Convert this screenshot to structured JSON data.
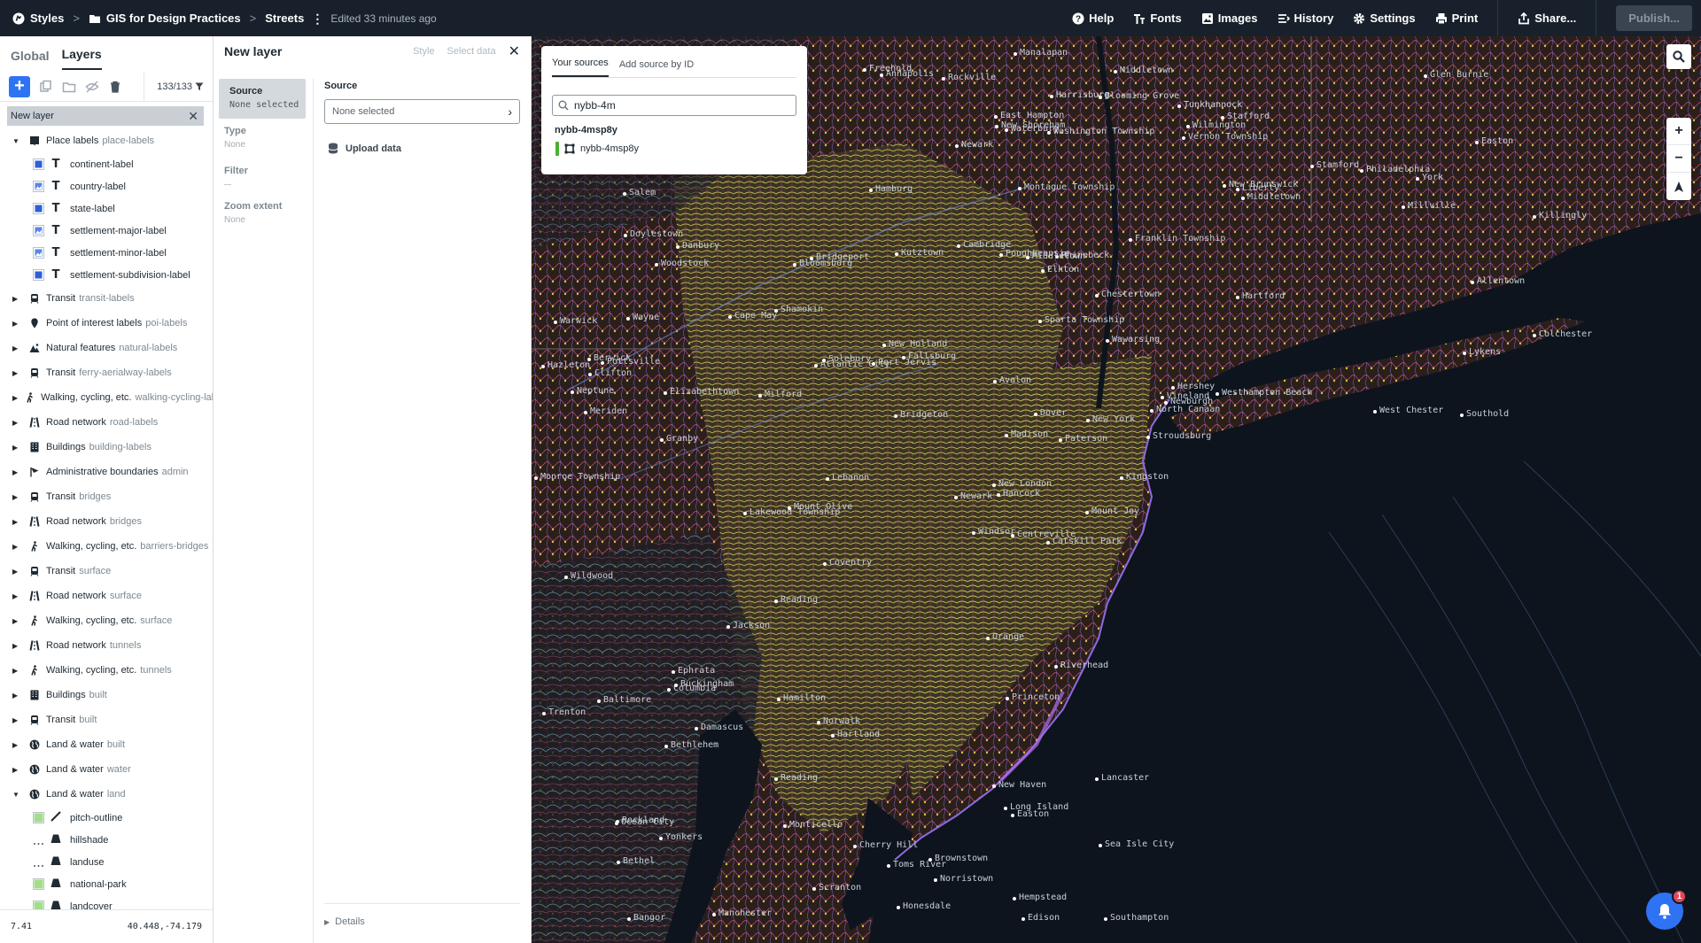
{
  "topbar": {
    "styles": "Styles",
    "project": "GIS for Design Practices",
    "style_name": "Streets",
    "edited": "Edited 33 minutes ago",
    "help": "Help",
    "fonts": "Fonts",
    "images": "Images",
    "history": "History",
    "settings": "Settings",
    "print": "Print",
    "share": "Share...",
    "publish": "Publish..."
  },
  "left_panel": {
    "tabs": [
      "Global",
      "Layers"
    ],
    "active_tab": "Layers",
    "layer_count": "133/133",
    "new_layer_row": "New layer",
    "groups": [
      {
        "name": "Place labels",
        "sub": "place-labels",
        "expanded": true,
        "icon": "label-icon",
        "children": [
          {
            "name": "continent-label",
            "swatch": "blue"
          },
          {
            "name": "country-label",
            "swatch": "image"
          },
          {
            "name": "state-label",
            "swatch": "blue"
          },
          {
            "name": "settlement-major-label",
            "swatch": "image"
          },
          {
            "name": "settlement-minor-label",
            "swatch": "image"
          },
          {
            "name": "settlement-subdivision-label",
            "swatch": "blue"
          }
        ]
      },
      {
        "name": "Transit",
        "sub": "transit-labels",
        "icon": "transit-icon"
      },
      {
        "name": "Point of interest labels",
        "sub": "poi-labels",
        "icon": "pin-icon"
      },
      {
        "name": "Natural features",
        "sub": "natural-labels",
        "icon": "mountain-icon"
      },
      {
        "name": "Transit",
        "sub": "ferry-aerialway-labels",
        "icon": "transit-icon"
      },
      {
        "name": "Walking, cycling, etc.",
        "sub": "walking-cycling-lal",
        "icon": "walker-icon"
      },
      {
        "name": "Road network",
        "sub": "road-labels",
        "icon": "road-icon"
      },
      {
        "name": "Buildings",
        "sub": "building-labels",
        "icon": "building-icon"
      },
      {
        "name": "Administrative boundaries",
        "sub": "admin",
        "icon": "flag-icon"
      },
      {
        "name": "Transit",
        "sub": "bridges",
        "icon": "transit-icon"
      },
      {
        "name": "Road network",
        "sub": "bridges",
        "icon": "road-icon"
      },
      {
        "name": "Walking, cycling, etc.",
        "sub": "barriers-bridges",
        "icon": "walker-icon"
      },
      {
        "name": "Transit",
        "sub": "surface",
        "icon": "transit-icon"
      },
      {
        "name": "Road network",
        "sub": "surface",
        "icon": "road-icon"
      },
      {
        "name": "Walking, cycling, etc.",
        "sub": "surface",
        "icon": "walker-icon"
      },
      {
        "name": "Road network",
        "sub": "tunnels",
        "icon": "road-icon"
      },
      {
        "name": "Walking, cycling, etc.",
        "sub": "tunnels",
        "icon": "walker-icon"
      },
      {
        "name": "Buildings",
        "sub": "built",
        "icon": "building-icon"
      },
      {
        "name": "Transit",
        "sub": "built",
        "icon": "transit-icon"
      },
      {
        "name": "Land & water",
        "sub": "built",
        "icon": "globe-icon"
      },
      {
        "name": "Land & water",
        "sub": "water",
        "icon": "globe-icon"
      },
      {
        "name": "Land & water",
        "sub": "land",
        "expanded": true,
        "icon": "globe-icon",
        "children": [
          {
            "name": "pitch-outline",
            "swatch": "green",
            "type": "line"
          },
          {
            "name": "hillshade",
            "swatch": "dots",
            "type": "fill"
          },
          {
            "name": "landuse",
            "swatch": "dots",
            "type": "fill"
          },
          {
            "name": "national-park",
            "swatch": "green",
            "type": "fill"
          },
          {
            "name": "landcover",
            "swatch": "green",
            "type": "fill"
          }
        ]
      }
    ],
    "footer_zoom": "7.41",
    "footer_coords": "40.448,-74.179"
  },
  "editor": {
    "title": "New layer",
    "tab_style": "Style",
    "tab_select_data": "Select data",
    "nav": [
      {
        "label": "Source",
        "value": "None selected",
        "active": true
      },
      {
        "label": "Type",
        "value": "None"
      },
      {
        "label": "Filter",
        "value": ""
      },
      {
        "label": "Zoom extent",
        "value": "None"
      }
    ],
    "source_label": "Source",
    "source_select": "None selected",
    "upload": "Upload data",
    "details": "Details"
  },
  "popup": {
    "tabs": [
      "Your sources",
      "Add source by ID"
    ],
    "search_value": "nybb-4m",
    "group": "nybb-4msp8y",
    "item": "nybb-4msp8y"
  },
  "map_labels": [
    "Catskill Park",
    "Woodstock",
    "Hancock",
    "Rockland",
    "North Canaan",
    "Hartland",
    "Stafford",
    "Rhinebeck",
    "Liberty",
    "Kingston",
    "Granby",
    "Killingly",
    "Windsor",
    "Hartford",
    "Manchester",
    "Poughkeepsie",
    "Wawarsing",
    "Damascus",
    "Fallsburg",
    "Bethel",
    "Monticello",
    "Middletown",
    "Newburgh",
    "Danbury",
    "Waterbury",
    "Meriden",
    "Colchester",
    "New London",
    "New Haven",
    "Madison",
    "Bridgeport",
    "Stamford",
    "Norwalk",
    "Middletown",
    "Port Jervis",
    "Milford",
    "Scranton",
    "Hazleton",
    "Stroudsburg",
    "Bangor",
    "Easton",
    "Bethlehem",
    "Allentown",
    "Reading",
    "Lancaster",
    "York",
    "Harrisburg",
    "Lebanon",
    "Pottsville",
    "Shamokin",
    "Philadelphia",
    "Wilmington",
    "Newark",
    "Dover",
    "Trenton",
    "Princeton",
    "Toms River",
    "Atlantic City",
    "Ocean City",
    "Cape May",
    "Wildwood",
    "Avalon",
    "Sea Isle City",
    "New York",
    "Yonkers",
    "Hempstead",
    "Southold",
    "Riverhead",
    "Southampton",
    "East Hampton",
    "Westhampton Beach",
    "Paterson",
    "Clifton",
    "Edison",
    "New Brunswick",
    "Middletown",
    "Lakewood Township",
    "Freehold",
    "Neptune",
    "Jackson",
    "Hamilton",
    "Cherry Hill",
    "Vineland",
    "Millville",
    "Bridgeton",
    "Salem",
    "Elkton",
    "Newark",
    "Annapolis",
    "Baltimore",
    "Centreville",
    "Easton",
    "Cambridge",
    "Rockville",
    "Columbia",
    "Glen Burnie",
    "Chestertown",
    "Kutztown",
    "Reading",
    "Norristown",
    "West Chester",
    "Doylestown",
    "Buckingham",
    "Solebury",
    "Hamburg",
    "Coventry",
    "Ephrata",
    "New Holland",
    "Elizabethtown",
    "Mount Joy",
    "Hershey",
    "Brownstown",
    "Long Island",
    "New Shoreham",
    "Lykens",
    "Bloomsburg",
    "Berwick",
    "Honesdale",
    "Blooming Grove",
    "Montague Township",
    "Sparta Township",
    "Mount Olive",
    "Franklin Township",
    "Washington Township",
    "Monroe Township",
    "Manalapan",
    "Vernon Township",
    "Wayne",
    "Orange",
    "Warwick",
    "Tunkhannock"
  ],
  "notifications_count": "1"
}
